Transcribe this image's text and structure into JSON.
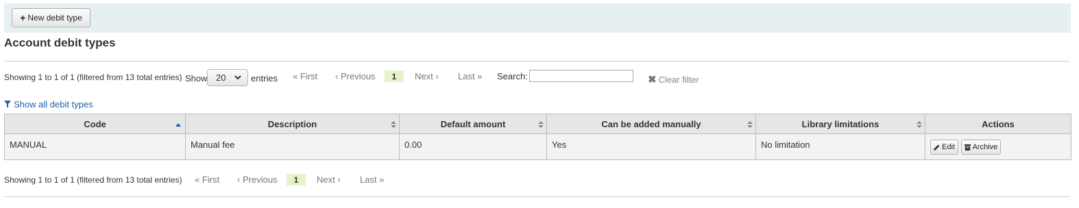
{
  "toolbar": {
    "new_button_label": "New debit type",
    "new_button_icon": "plus-icon"
  },
  "page_title": "Account debit types",
  "top_info": {
    "showing": "Showing 1 to 1 of 1 (filtered from 13 total entries)",
    "show_label": "Show",
    "entries_label": "entries",
    "page_length": "20"
  },
  "pager": {
    "first": "First",
    "previous": "Previous",
    "current": "1",
    "next": "Next",
    "last": "Last"
  },
  "search": {
    "label": "Search:",
    "value": "",
    "placeholder": ""
  },
  "clear_filter": "Clear filter",
  "show_all": "Show all debit types",
  "table": {
    "headers": [
      "Code",
      "Description",
      "Default amount",
      "Can be added manually",
      "Library limitations",
      "Actions"
    ],
    "rows": [
      {
        "code": "MANUAL",
        "description": "Manual fee",
        "default_amount": "0.00",
        "can_be_added_manually": "Yes",
        "library_limitations": "No limitation",
        "edit_label": "Edit",
        "archive_label": "Archive"
      }
    ]
  },
  "bottom_info": {
    "showing": "Showing 1 to 1 of 1 (filtered from 13 total entries)"
  },
  "colors": {
    "toolbar_bg": "#e6f0f2",
    "link": "#1f5fa6",
    "current_page_bg": "#e6f3c9",
    "header_bg": "#e6e6e6",
    "row_bg": "#f3f3f3"
  }
}
